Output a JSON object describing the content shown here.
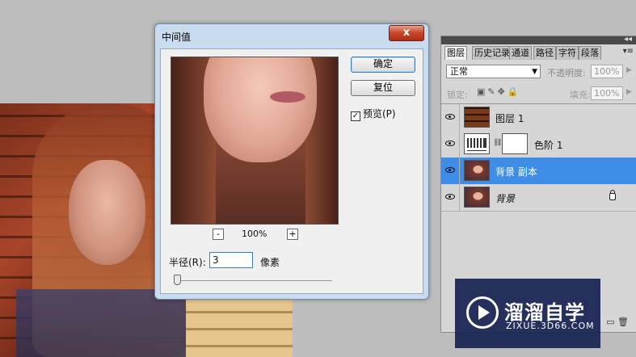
{
  "dialog": {
    "title": "中间值",
    "close_label": "x",
    "ok_label": "确定",
    "reset_label": "复位",
    "preview_label": "预览(P)",
    "preview_checked": "✓",
    "zoom_out": "-",
    "zoom_in": "+",
    "zoom_level": "100%",
    "radius_label": "半径(R):",
    "radius_value": "3",
    "unit_label": "像素"
  },
  "layers_panel": {
    "collapse": "◂◂",
    "tabs": [
      "图层",
      "历史记录",
      "通道",
      "路径",
      "字符",
      "段落"
    ],
    "menu_icon": "▾≡",
    "blend_mode": "正常",
    "opacity_label": "不透明度:",
    "opacity_value": "100%",
    "lock_label": "锁定:",
    "lock_icons": "▣✎✥🔒",
    "fill_label": "填充:",
    "fill_value": "100%",
    "layers": [
      {
        "name": "图层 1"
      },
      {
        "name": "色阶 1"
      },
      {
        "name": "背景 副本"
      },
      {
        "name": "背景"
      }
    ],
    "bottom_icons": "▭ 🗑"
  },
  "watermark": {
    "cn": "溜溜自学",
    "en": "ZIXUE.3D66.COM"
  }
}
